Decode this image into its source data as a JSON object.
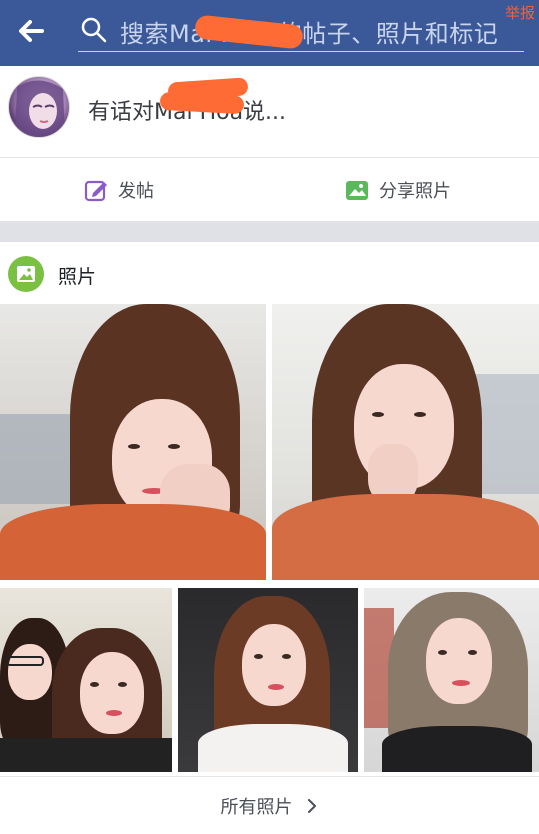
{
  "header": {
    "search_placeholder": "搜索Mai Hoa 的帖子、照片和标记",
    "report_label": "举报"
  },
  "composer": {
    "prompt": "有话对Mai Hoa说..."
  },
  "actions": {
    "post_label": "发帖",
    "share_photo_label": "分享照片"
  },
  "photos": {
    "title": "照片",
    "all_photos_label": "所有照片"
  },
  "colors": {
    "header_bg": "#3b5998",
    "accent_green": "#7ac143",
    "redaction": "#ff6b35"
  },
  "icons": [
    "back-arrow-icon",
    "search-icon",
    "edit-post-icon",
    "image-icon",
    "photos-icon",
    "chevron-right-icon"
  ]
}
